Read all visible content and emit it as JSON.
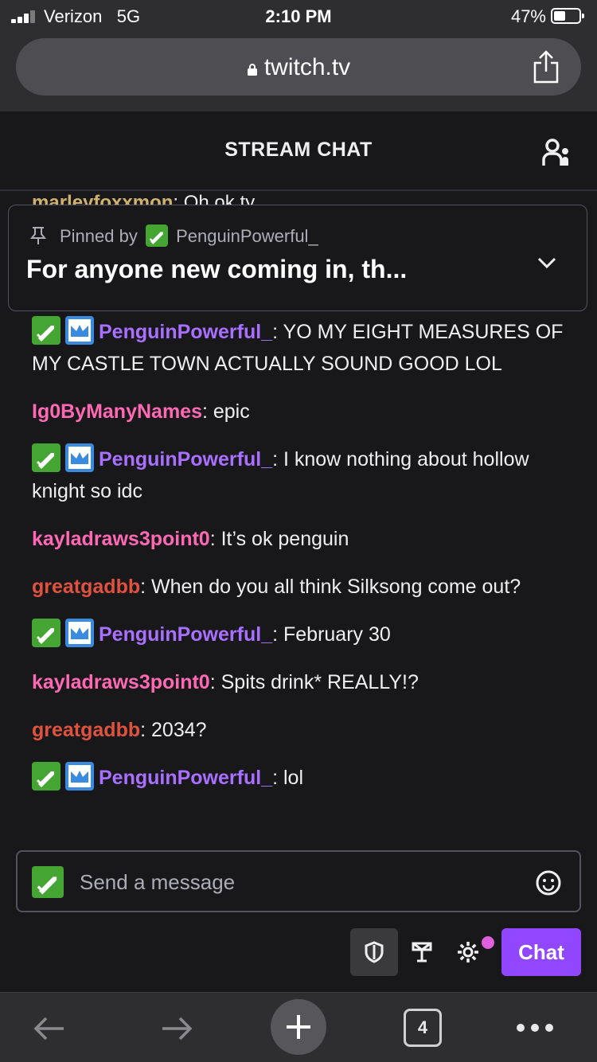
{
  "status_bar": {
    "carrier": "Verizon",
    "network": "5G",
    "time": "2:10 PM",
    "battery": "47%",
    "battery_level": 0.47
  },
  "browser": {
    "url": "twitch.tv",
    "tab_count": "4"
  },
  "header": {
    "title": "STREAM CHAT"
  },
  "peek_line": {
    "user": "marleyfoxxmon",
    "text": ": Oh ok ty"
  },
  "pinned": {
    "pinned_by_label": "Pinned by",
    "pinned_by_user": "PenguinPowerful_",
    "text": "For anyone new coming in, th..."
  },
  "messages": [
    {
      "user": "PenguinPowerful_",
      "user_color": "#a970ff",
      "badges": [
        "sword",
        "crown"
      ],
      "text": ": YO MY EIGHT MEASURES OF MY CASTLE TOWN ACTUALLY SOUND GOOD LOL"
    },
    {
      "user": "Ig0ByManyNames",
      "user_color": "#ff69b4",
      "badges": [],
      "text": ": epic"
    },
    {
      "user": "PenguinPowerful_",
      "user_color": "#a970ff",
      "badges": [
        "sword",
        "crown"
      ],
      "text": ": I know nothing about hollow knight so idc"
    },
    {
      "user": "kayladraws3point0",
      "user_color": "#ff69b4",
      "badges": [],
      "text": ": It’s ok penguin"
    },
    {
      "user": "greatgadbb",
      "user_color": "#e0523e",
      "badges": [],
      "text": ": When do you all think Silksong come out?"
    },
    {
      "user": "PenguinPowerful_",
      "user_color": "#a970ff",
      "badges": [
        "sword",
        "crown"
      ],
      "text": ": February 30"
    },
    {
      "user": "kayladraws3point0",
      "user_color": "#ff69b4",
      "badges": [],
      "text": ": Spits drink* REALLY!?"
    },
    {
      "user": "greatgadbb",
      "user_color": "#e0523e",
      "badges": [],
      "text": ": 2034?"
    },
    {
      "user": "PenguinPowerful_",
      "user_color": "#a970ff",
      "badges": [
        "sword",
        "crown"
      ],
      "text": ": lol"
    }
  ],
  "input": {
    "placeholder": "Send a message"
  },
  "controls": {
    "chat_button": "Chat"
  },
  "colors": {
    "accent": "#9147ff",
    "badge_green": "#45a533",
    "badge_blue": "#3a8be0",
    "notification": "#e05fde"
  },
  "icons": [
    "lock-icon",
    "share-icon",
    "users-icon",
    "pin-icon",
    "chevron-down-icon",
    "sword-badge-icon",
    "crown-badge-icon",
    "emoji-icon",
    "shield-icon",
    "channel-points-icon",
    "settings-icon",
    "back-arrow-icon",
    "forward-arrow-icon",
    "plus-icon",
    "tabs-icon",
    "more-icon"
  ]
}
